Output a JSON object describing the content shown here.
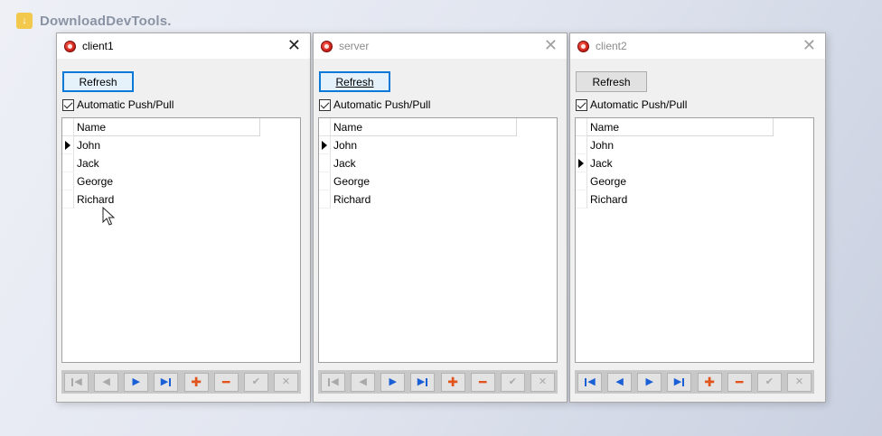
{
  "watermark": {
    "text": "DownloadDevTools."
  },
  "windows": [
    {
      "title": "client1",
      "refresh_label": "Refresh",
      "auto_label": "Automatic Push/Pull",
      "column_header": "Name",
      "rows": [
        "John",
        "Jack",
        "George",
        "Richard"
      ],
      "current_row": 0
    },
    {
      "title": "server",
      "refresh_label": "Refresh",
      "auto_label": "Automatic Push/Pull",
      "column_header": "Name",
      "rows": [
        "John",
        "Jack",
        "George",
        "Richard"
      ],
      "current_row": 0
    },
    {
      "title": "client2",
      "refresh_label": "Refresh",
      "auto_label": "Automatic Push/Pull",
      "column_header": "Name",
      "rows": [
        "John",
        "Jack",
        "George",
        "Richard"
      ],
      "current_row": 1
    }
  ],
  "navigator_icons": {
    "first": "first-record-icon",
    "prior": "prior-record-icon",
    "next": "next-record-icon",
    "last": "last-record-icon",
    "insert": "plus-icon",
    "delete": "minus-icon",
    "post": "check-icon",
    "cancel": "x-icon"
  },
  "colors": {
    "focus_blue": "#0a78d7",
    "nav_blue": "#1a5fd6",
    "nav_orange": "#e2541b",
    "nav_gray": "#a9a9a9"
  }
}
